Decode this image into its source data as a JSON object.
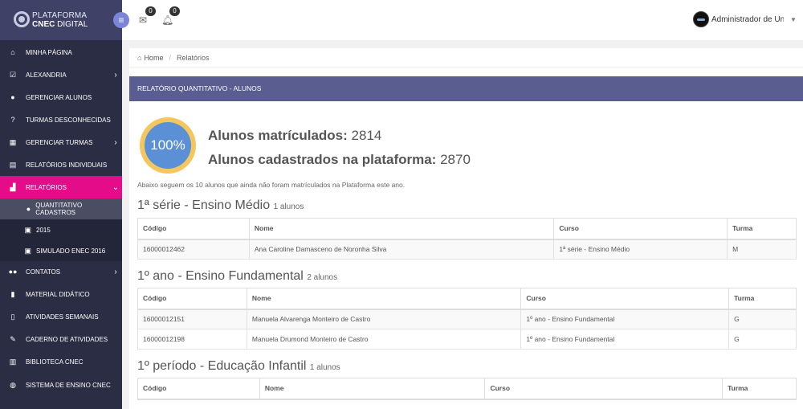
{
  "brand": {
    "line1": "PLATAFORMA",
    "line2a": "CNEC",
    "line2b": "DIGITAL"
  },
  "header": {
    "mail_badge": "0",
    "bell_badge": "0",
    "username": "Administrador de Unidade"
  },
  "sidebar": {
    "items": [
      {
        "label": "Minha Página",
        "icon": "home-icon"
      },
      {
        "label": "Alexandria",
        "icon": "check-square-icon",
        "has_arrow": true
      },
      {
        "label": "Gerenciar Alunos",
        "icon": "user-icon"
      },
      {
        "label": "Turmas Desconhecidas",
        "icon": "question-icon"
      },
      {
        "label": "Gerenciar Turmas",
        "icon": "grid-icon",
        "has_arrow": true
      },
      {
        "label": "Relatórios Individuais",
        "icon": "document-icon"
      },
      {
        "label": "Relatórios",
        "icon": "chart-icon",
        "active": true
      },
      {
        "label": "Contatos",
        "icon": "users-icon",
        "has_arrow": true
      },
      {
        "label": "Material Didático",
        "icon": "book-icon"
      },
      {
        "label": "Atividades Semanais",
        "icon": "file-icon"
      },
      {
        "label": "Caderno de Atividades",
        "icon": "edit-icon"
      },
      {
        "label": "Biblioteca CNEC",
        "icon": "library-icon"
      },
      {
        "label": "Sistema de Ensino CNEC",
        "icon": "globe-icon"
      }
    ],
    "subitems": [
      {
        "label": "QUANTITATIVO CADASTROS",
        "icon": "user-icon"
      },
      {
        "label": "2015",
        "icon": "calendar-icon"
      },
      {
        "label": "SIMULADO ENEC 2016",
        "icon": "calendar-icon"
      }
    ]
  },
  "breadcrumb": {
    "home": "Home",
    "current": "Relatórios"
  },
  "panel": {
    "title": "RELATÓRIO QUANTITATIVO - ALUNOS"
  },
  "summary": {
    "percent": "100%",
    "enrolled_label": "Alunos matrículados:",
    "enrolled_value": "2814",
    "registered_label": "Alunos cadastrados na plataforma:",
    "registered_value": "2870",
    "info": "Abaixo seguem os 10 alunos que ainda não foram matrículados na Plataforma este ano."
  },
  "columns": [
    "Código",
    "Nome",
    "Curso",
    "Turma"
  ],
  "sections": [
    {
      "title": "1ª série - Ensino Médio",
      "count": "1 alunos",
      "rows": [
        [
          "16000012462",
          "Ana Caroline Damasceno de Noronha Silva",
          "1ª série - Ensino Médio",
          "M"
        ]
      ]
    },
    {
      "title": "1º ano - Ensino Fundamental",
      "count": "2 alunos",
      "rows": [
        [
          "16000012151",
          "Manuela Alvarenga Monteiro de Castro",
          "1º ano - Ensino Fundamental",
          "G"
        ],
        [
          "16000012198",
          "Manuela Drumond Monteiro de Castro",
          "1º ano - Ensino Fundamental",
          "G"
        ]
      ]
    },
    {
      "title": "1º período - Educação Infantil",
      "count": "1 alunos",
      "rows": []
    }
  ],
  "colors": {
    "sidebar": "#2b2d44",
    "brand": "#3f4166",
    "active": "#e50c8a",
    "panel": "#5a5d90",
    "ring": "#f3c75e",
    "ring_fill": "#5b8fd6"
  }
}
